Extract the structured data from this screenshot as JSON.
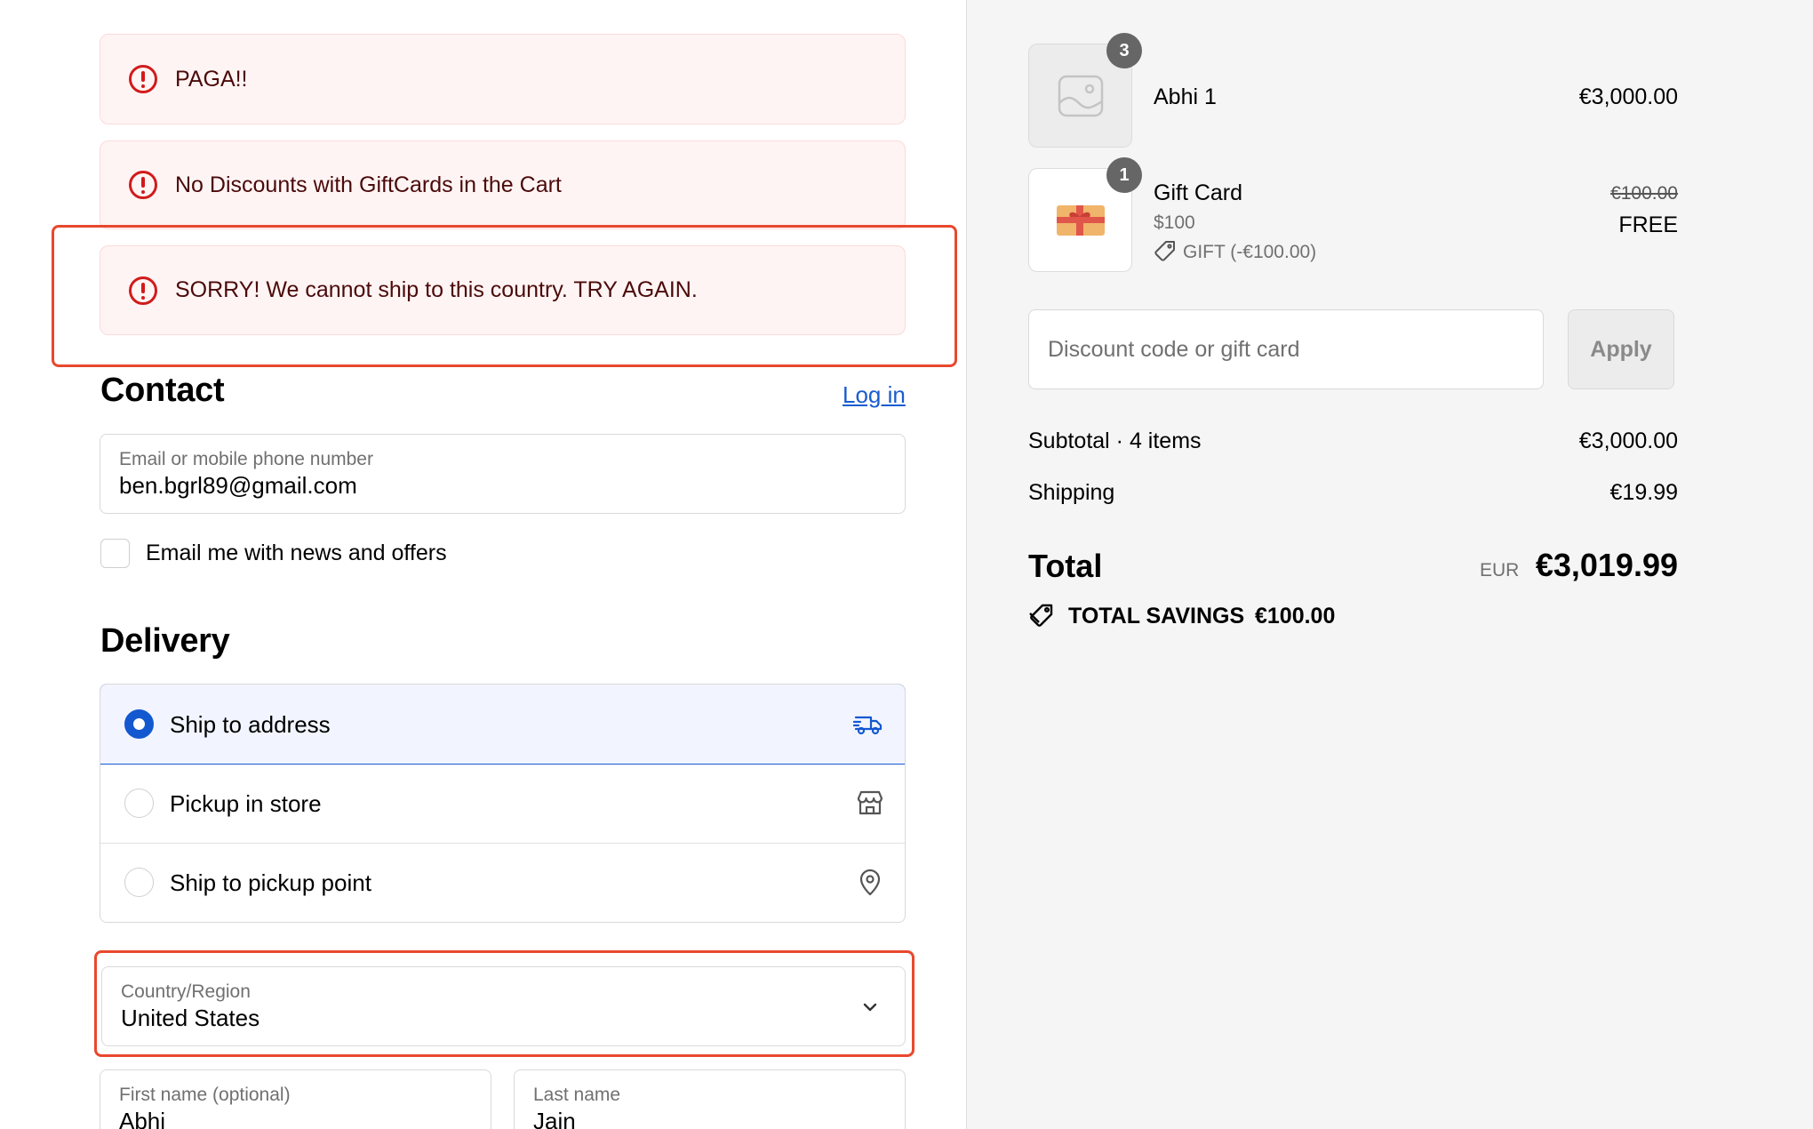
{
  "alerts": [
    {
      "message": "PAGA!!"
    },
    {
      "message": "No Discounts with GiftCards in the Cart"
    },
    {
      "message": "SORRY! We cannot ship to this country. TRY AGAIN."
    }
  ],
  "contact": {
    "title": "Contact",
    "login_link": "Log in",
    "email_label": "Email or mobile phone number",
    "email_value": "ben.bgrl89@gmail.com",
    "news_checkbox_label": "Email me with news and offers",
    "news_checked": false
  },
  "delivery": {
    "title": "Delivery",
    "options": [
      {
        "label": "Ship to address",
        "icon": "truck-icon",
        "selected": true
      },
      {
        "label": "Pickup in store",
        "icon": "store-icon",
        "selected": false
      },
      {
        "label": "Ship to pickup point",
        "icon": "location-pin-icon",
        "selected": false
      }
    ],
    "country_label": "Country/Region",
    "country_value": "United States",
    "first_name_label": "First name (optional)",
    "first_name_value": "Abhi",
    "last_name_label": "Last name",
    "last_name_value": "Jain"
  },
  "cart": {
    "items": [
      {
        "name": "Abhi 1",
        "quantity": "3",
        "price": "€3,000.00"
      },
      {
        "name": "Gift Card",
        "quantity": "1",
        "variant": "$100",
        "discount_tag": "GIFT (-€100.00)",
        "original_price": "€100.00",
        "price": "FREE"
      }
    ],
    "discount_placeholder": "Discount code or gift card",
    "apply_label": "Apply",
    "subtotal_label": "Subtotal · 4 items",
    "subtotal_value": "€3,000.00",
    "shipping_label": "Shipping",
    "shipping_value": "€19.99",
    "total_label": "Total",
    "currency": "EUR",
    "total_value": "€3,019.99",
    "savings_label": "TOTAL SAVINGS",
    "savings_value": "€100.00"
  },
  "colors": {
    "alert_bg": "#fff4f4",
    "alert_icon": "#d11b1b",
    "highlight": "#e8482e",
    "accent": "#1458d0"
  }
}
